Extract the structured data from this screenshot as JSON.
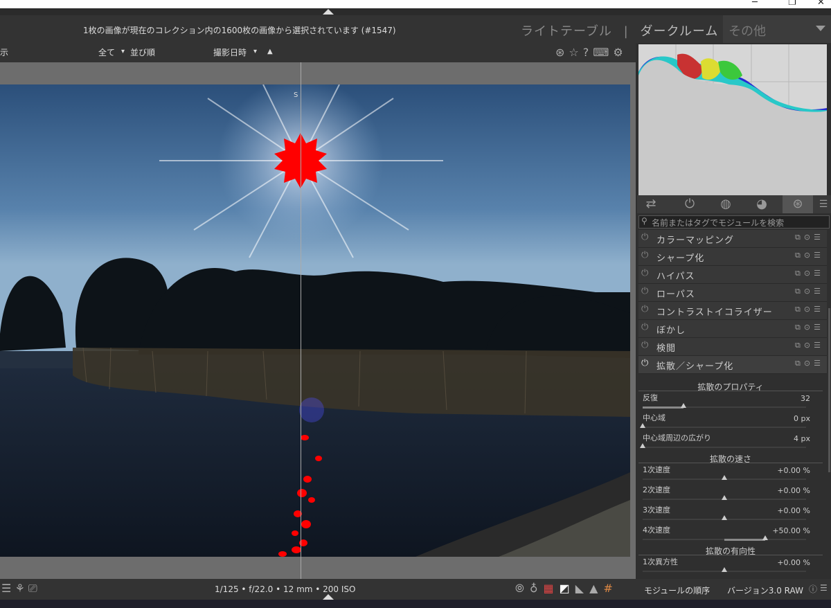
{
  "window": {
    "minimize": "─",
    "restore": "❐",
    "close": "✕"
  },
  "header": {
    "status_message": "1枚の画像が現在のコレクション内の1600枚の画像から選択されています (#1547)",
    "views": {
      "lighttable": "ライトテーブル",
      "sep1": "|",
      "darkroom": "ダークルーム",
      "sep2": "|",
      "more": "その他"
    }
  },
  "filterbar": {
    "show_label": "示",
    "all_label": "全て",
    "all_caret": "▾",
    "sort_label": "並び順",
    "sort_value": "撮影日時",
    "sort_caret": "▾",
    "sort_dir": "▲",
    "icons": [
      "grid-icon",
      "star-icon",
      "help-icon",
      "keyboard-icon",
      "settings-icon"
    ]
  },
  "canvas": {
    "split_marker": "S"
  },
  "histogram": {
    "colors": {
      "bg": "#d6d6d6",
      "red": "#c83232",
      "green": "#3cc83c",
      "blue": "#2828d2",
      "yellow": "#dcdc32",
      "cyan": "#28c8c8"
    }
  },
  "tabs": {
    "icons": [
      "sliders-icon",
      "power-icon",
      "base-icon",
      "color-icon",
      "effects-icon",
      "menu-icon"
    ]
  },
  "search": {
    "placeholder": "名前またはタグでモジュールを検索"
  },
  "modules": [
    {
      "name": "カラーマッピング",
      "active": false
    },
    {
      "name": "シャープ化",
      "active": false
    },
    {
      "name": "ハイパス",
      "active": false
    },
    {
      "name": "ローパス",
      "active": false
    },
    {
      "name": "コントラストイコライザー",
      "active": false
    },
    {
      "name": "ぼかし",
      "active": false
    },
    {
      "name": "検閲",
      "active": false
    },
    {
      "name": "拡散／シャープ化",
      "active": true
    }
  ],
  "properties": {
    "section_props": "拡散のプロパティ",
    "iterations": {
      "label": "反復",
      "value": "32",
      "level": 0.25
    },
    "central_radius": {
      "label": "中心域",
      "value": "0 px",
      "level": 0
    },
    "radius_span": {
      "label": "中心域周辺の広がり",
      "value": "4 px",
      "level": 0
    },
    "section_speed": "拡散の速さ",
    "speed1": {
      "label": "1次速度",
      "value": "+0.00 %",
      "level": 0.5
    },
    "speed2": {
      "label": "2次速度",
      "value": "+0.00 %",
      "level": 0.5
    },
    "speed3": {
      "label": "3次速度",
      "value": "+0.00 %",
      "level": 0.5
    },
    "speed4": {
      "label": "4次速度",
      "value": "+50.00 %",
      "level": 0.75
    },
    "section_direction": "拡散の有向性",
    "aniso1": {
      "label": "1次異方性",
      "value": "+0.00 %",
      "level": 0.5
    }
  },
  "bottombar": {
    "exif": "1/125 • f/22.0 • 12 mm • 200 ISO",
    "module_order": "モジュールの順序",
    "version": "バージョン3.0 RAW",
    "info_icon": "ⓘ",
    "menu_icon": "☰"
  }
}
